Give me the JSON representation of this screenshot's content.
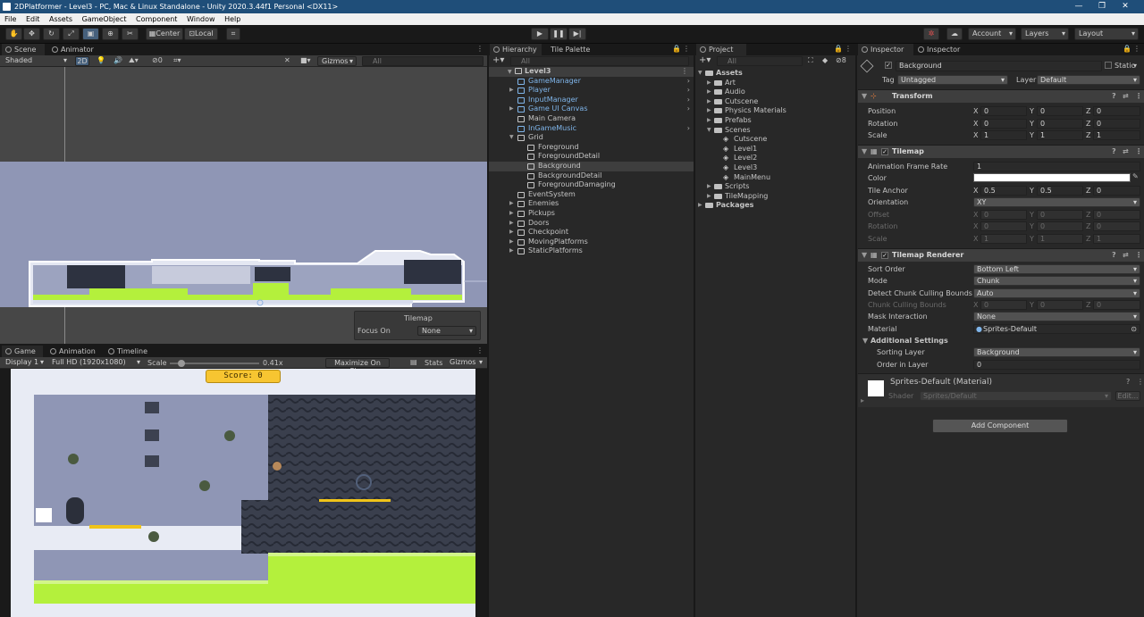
{
  "window": {
    "title": "2DPlatformer - Level3 - PC, Mac & Linux Standalone - Unity 2020.3.44f1 Personal <DX11>"
  },
  "menu": [
    "File",
    "Edit",
    "Assets",
    "GameObject",
    "Component",
    "Window",
    "Help"
  ],
  "toolbar": {
    "center": "Center",
    "local": "Local",
    "account": "Account",
    "layers": "Layers",
    "layout": "Layout"
  },
  "scene": {
    "tabs": [
      "Scene",
      "Animator"
    ],
    "shading": "Shaded",
    "mode2d": "2D",
    "hidden_count": "0",
    "gizmos": "Gizmos",
    "search_placeholder": "All",
    "overlay": {
      "title": "Tilemap",
      "focus_label": "Focus On",
      "focus_value": "None"
    }
  },
  "game": {
    "tabs": [
      "Game",
      "Animation",
      "Timeline"
    ],
    "display": "Display 1",
    "resolution": "Full HD (1920x1080)",
    "scale_label": "Scale",
    "scale_value": "0.41x",
    "scale_fraction": 0.1,
    "maximize": "Maximize On Play",
    "stats": "Stats",
    "gizmos": "Gizmos",
    "score": "Score: 0"
  },
  "hierarchy": {
    "tabs": [
      "Hierarchy",
      "Tile Palette"
    ],
    "search_placeholder": "All",
    "scene": "Level3",
    "items": [
      {
        "label": "GameManager",
        "prefab": true,
        "depth": 1,
        "foldout": "none"
      },
      {
        "label": "Player",
        "prefab": true,
        "depth": 1,
        "foldout": "closed"
      },
      {
        "label": "InputManager",
        "prefab": true,
        "depth": 1,
        "foldout": "none"
      },
      {
        "label": "Game UI Canvas",
        "prefab": true,
        "depth": 1,
        "foldout": "closed"
      },
      {
        "label": "Main Camera",
        "prefab": false,
        "depth": 1,
        "foldout": "none"
      },
      {
        "label": "InGameMusic",
        "prefab": true,
        "depth": 1,
        "foldout": "none"
      },
      {
        "label": "Grid",
        "prefab": false,
        "depth": 1,
        "foldout": "open"
      },
      {
        "label": "Foreground",
        "prefab": false,
        "depth": 2,
        "foldout": "none"
      },
      {
        "label": "ForegroundDetail",
        "prefab": false,
        "depth": 2,
        "foldout": "none"
      },
      {
        "label": "Background",
        "prefab": false,
        "depth": 2,
        "foldout": "none",
        "selected": true
      },
      {
        "label": "BackgroundDetail",
        "prefab": false,
        "depth": 2,
        "foldout": "none"
      },
      {
        "label": "ForegroundDamaging",
        "prefab": false,
        "depth": 2,
        "foldout": "none"
      },
      {
        "label": "EventSystem",
        "prefab": false,
        "depth": 1,
        "foldout": "none"
      },
      {
        "label": "Enemies",
        "prefab": false,
        "depth": 1,
        "foldout": "closed"
      },
      {
        "label": "Pickups",
        "prefab": false,
        "depth": 1,
        "foldout": "closed"
      },
      {
        "label": "Doors",
        "prefab": false,
        "depth": 1,
        "foldout": "closed"
      },
      {
        "label": "Checkpoint",
        "prefab": false,
        "depth": 1,
        "foldout": "closed"
      },
      {
        "label": "MovingPlatforms",
        "prefab": false,
        "depth": 1,
        "foldout": "closed"
      },
      {
        "label": "StaticPlatforms",
        "prefab": false,
        "depth": 1,
        "foldout": "closed"
      }
    ]
  },
  "project": {
    "tab": "Project",
    "search_placeholder": "All",
    "hidden_count": "8",
    "items": [
      {
        "label": "Assets",
        "depth": 0,
        "foldout": "open",
        "type": "folder",
        "bold": true
      },
      {
        "label": "Art",
        "depth": 1,
        "foldout": "closed",
        "type": "folder"
      },
      {
        "label": "Audio",
        "depth": 1,
        "foldout": "closed",
        "type": "folder"
      },
      {
        "label": "Cutscene",
        "depth": 1,
        "foldout": "closed",
        "type": "folder"
      },
      {
        "label": "Physics Materials",
        "depth": 1,
        "foldout": "closed",
        "type": "folder"
      },
      {
        "label": "Prefabs",
        "depth": 1,
        "foldout": "closed",
        "type": "folder"
      },
      {
        "label": "Scenes",
        "depth": 1,
        "foldout": "open",
        "type": "folder"
      },
      {
        "label": "Cutscene",
        "depth": 2,
        "foldout": "none",
        "type": "scene"
      },
      {
        "label": "Level1",
        "depth": 2,
        "foldout": "none",
        "type": "scene"
      },
      {
        "label": "Level2",
        "depth": 2,
        "foldout": "none",
        "type": "scene"
      },
      {
        "label": "Level3",
        "depth": 2,
        "foldout": "none",
        "type": "scene"
      },
      {
        "label": "MainMenu",
        "depth": 2,
        "foldout": "none",
        "type": "scene"
      },
      {
        "label": "Scripts",
        "depth": 1,
        "foldout": "closed",
        "type": "folder"
      },
      {
        "label": "TileMapping",
        "depth": 1,
        "foldout": "closed",
        "type": "folder"
      },
      {
        "label": "Packages",
        "depth": 0,
        "foldout": "closed",
        "type": "folder",
        "bold": true
      }
    ]
  },
  "inspector": {
    "tabs": [
      "Inspector",
      "Inspector"
    ],
    "object_name": "Background",
    "static_label": "Static",
    "tag_label": "Tag",
    "tag_value": "Untagged",
    "layer_label": "Layer",
    "layer_value": "Default",
    "transform": {
      "title": "Transform",
      "rows": [
        {
          "label": "Position",
          "x": "0",
          "y": "0",
          "z": "0"
        },
        {
          "label": "Rotation",
          "x": "0",
          "y": "0",
          "z": "0"
        },
        {
          "label": "Scale",
          "x": "1",
          "y": "1",
          "z": "1"
        }
      ]
    },
    "tilemap": {
      "title": "Tilemap",
      "frame_rate_label": "Animation Frame Rate",
      "frame_rate": "1",
      "color_label": "Color",
      "color": "#ffffff",
      "anchor_label": "Tile Anchor",
      "anchor": {
        "x": "0.5",
        "y": "0.5",
        "z": "0"
      },
      "orientation_label": "Orientation",
      "orientation": "XY",
      "offset": {
        "label": "Offset",
        "x": "0",
        "y": "0",
        "z": "0"
      },
      "rotation": {
        "label": "Rotation",
        "x": "0",
        "y": "0",
        "z": "0"
      },
      "scale": {
        "label": "Scale",
        "x": "1",
        "y": "1",
        "z": "1"
      }
    },
    "renderer": {
      "title": "Tilemap Renderer",
      "sort_order_label": "Sort Order",
      "sort_order": "Bottom Left",
      "mode_label": "Mode",
      "mode": "Chunk",
      "detect_label": "Detect Chunk Culling Bounds",
      "detect": "Auto",
      "bounds": {
        "label": "Chunk Culling Bounds",
        "x": "0",
        "y": "0",
        "z": "0"
      },
      "mask_label": "Mask Interaction",
      "mask": "None",
      "material_label": "Material",
      "material": "Sprites-Default",
      "additional": "Additional Settings",
      "sorting_layer_label": "Sorting Layer",
      "sorting_layer": "Background",
      "order_label": "Order in Layer",
      "order": "0"
    },
    "material": {
      "name": "Sprites-Default (Material)",
      "shader_label": "Shader",
      "shader": "Sprites/Default",
      "edit": "Edit..."
    },
    "add_component": "Add Component"
  },
  "colors": {
    "accent": "#1f4e79",
    "selected_row": "#3e3e3e",
    "prefab_text": "#7fb5ea",
    "scene_bg": "#8f96b5",
    "game_grass": "#b4f03c"
  }
}
